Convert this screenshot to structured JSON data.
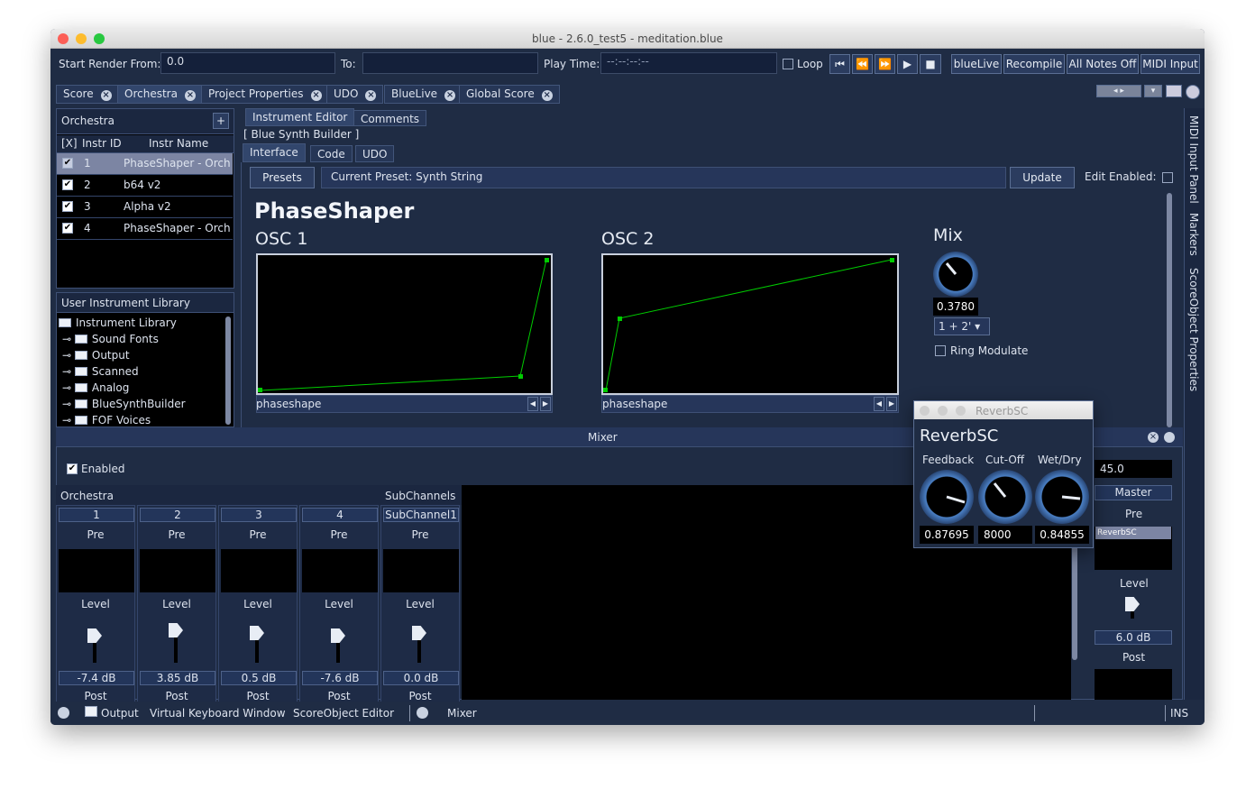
{
  "window": {
    "title": "blue - 2.6.0_test5 - meditation.blue"
  },
  "toolbar": {
    "start_render_label": "Start Render From:",
    "start_render_value": "0.0",
    "to_label": "To:",
    "to_value": "",
    "play_time_label": "Play Time:",
    "play_time_value": "--:--:--:--",
    "loop_label": "Loop",
    "bluelive": "blueLive",
    "recompile": "Recompile",
    "all_notes_off": "All Notes Off",
    "midi_input": "MIDI Input"
  },
  "tabs": [
    "Score",
    "Orchestra",
    "Project Properties",
    "UDO",
    "BlueLive",
    "Global Score"
  ],
  "orchestra": {
    "title": "Orchestra",
    "add": "+",
    "columns": [
      "[X]",
      "Instr ID",
      "Instr Name"
    ],
    "rows": [
      {
        "id": "1",
        "name": "PhaseShaper - Orch",
        "enabled": true,
        "selected": true
      },
      {
        "id": "2",
        "name": "b64 v2",
        "enabled": true
      },
      {
        "id": "3",
        "name": "Alpha v2",
        "enabled": true
      },
      {
        "id": "4",
        "name": "PhaseShaper - Orch",
        "enabled": true
      }
    ]
  },
  "library": {
    "title": "User Instrument Library",
    "root": "Instrument Library",
    "items": [
      "Sound Fonts",
      "Output",
      "Scanned",
      "Analog",
      "BlueSynthBuilder",
      "FOF Voices"
    ]
  },
  "editor": {
    "tabs": [
      "Instrument Editor",
      "Comments"
    ],
    "builder_label": "[ Blue Synth Builder ]",
    "subtabs": [
      "Interface",
      "Code",
      "UDO"
    ],
    "presets": "Presets",
    "current_preset": "Current Preset: Synth String",
    "update": "Update",
    "edit_enabled": "Edit Enabled:",
    "instrument_title": "PhaseShaper",
    "osc1": "OSC 1",
    "osc2": "OSC 2",
    "phaseshape1": "phaseshape",
    "phaseshape2": "phaseshape",
    "mix_label": "Mix",
    "mix_value": "0.3780",
    "mix_select": "1 + 2'",
    "ring_mod": "Ring Modulate"
  },
  "side_panels": [
    "MIDI Input Panel",
    "Markers",
    "ScoreObject Properties"
  ],
  "mixer": {
    "title": "Mixer",
    "enabled": "Enabled",
    "orchestra_label": "Orchestra",
    "subchannels_label": "SubChannels",
    "channels": [
      {
        "num": "1",
        "pre": "Pre",
        "level": "Level",
        "db": "-7.4 dB",
        "post": "Post"
      },
      {
        "num": "2",
        "pre": "Pre",
        "level": "Level",
        "db": "3.85 dB",
        "post": "Post"
      },
      {
        "num": "3",
        "pre": "Pre",
        "level": "Level",
        "db": "0.5 dB",
        "post": "Post"
      },
      {
        "num": "4",
        "pre": "Pre",
        "level": "Level",
        "db": "-7.6 dB",
        "post": "Post"
      },
      {
        "num": "SubChannel1",
        "pre": "Pre",
        "level": "Level",
        "db": "0.0 dB",
        "post": "Post"
      }
    ],
    "master": {
      "value": "45.0",
      "name": "Master",
      "pre": "Pre",
      "effect": "ReverbSC",
      "level": "Level",
      "db": "6.0 dB",
      "post": "Post"
    }
  },
  "reverb": {
    "window_title": "ReverbSC",
    "heading": "ReverbSC",
    "knobs": [
      {
        "label": "Feedback",
        "value": "0.87695"
      },
      {
        "label": "Cut-Off",
        "value": "8000"
      },
      {
        "label": "Wet/Dry",
        "value": "0.84855"
      }
    ]
  },
  "statusbar": {
    "output": "Output",
    "vkw": "Virtual Keyboard Window",
    "soe": "ScoreObject Editor",
    "mixer": "Mixer",
    "ins": "INS"
  },
  "colors": {
    "bg": "#1f2c44",
    "accent": "#4a7fc4",
    "graph": "#00cc00"
  }
}
